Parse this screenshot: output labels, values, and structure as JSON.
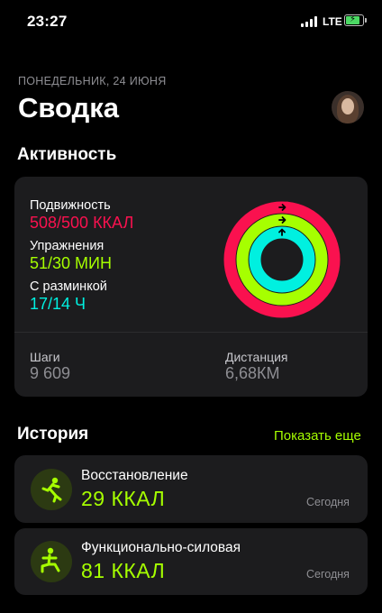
{
  "status_bar": {
    "time": "23:27",
    "network": "LTE"
  },
  "header": {
    "date": "ПОНЕДЕЛЬНИК, 24 ИЮНЯ",
    "title": "Сводка"
  },
  "activity": {
    "section_title": "Активность",
    "move": {
      "label": "Подвижность",
      "value": "508/500 ККАЛ",
      "progress": 1.016,
      "color": "#fa114f"
    },
    "exercise": {
      "label": "Упражнения",
      "value": "51/30 МИН",
      "progress": 1.7,
      "color": "#a6ff00"
    },
    "stand": {
      "label": "С разминкой",
      "value": "17/14 Ч",
      "progress": 1.214,
      "color": "#00f0e0"
    },
    "steps": {
      "label": "Шаги",
      "value": "9 609"
    },
    "distance": {
      "label": "Дистанция",
      "value": "6,68КМ"
    }
  },
  "history": {
    "section_title": "История",
    "show_more": "Показать еще",
    "items": [
      {
        "title": "Восстановление",
        "value": "29 ККАЛ",
        "date": "Сегодня",
        "icon": "stretching-figure-icon"
      },
      {
        "title": "Функционально-силовая",
        "value": "81 ККАЛ",
        "date": "Сегодня",
        "icon": "strength-figure-icon"
      }
    ]
  },
  "colors": {
    "accent": "#a6ff00",
    "move": "#fa114f",
    "stand": "#00f0e0",
    "card": "#1c1c1e"
  }
}
